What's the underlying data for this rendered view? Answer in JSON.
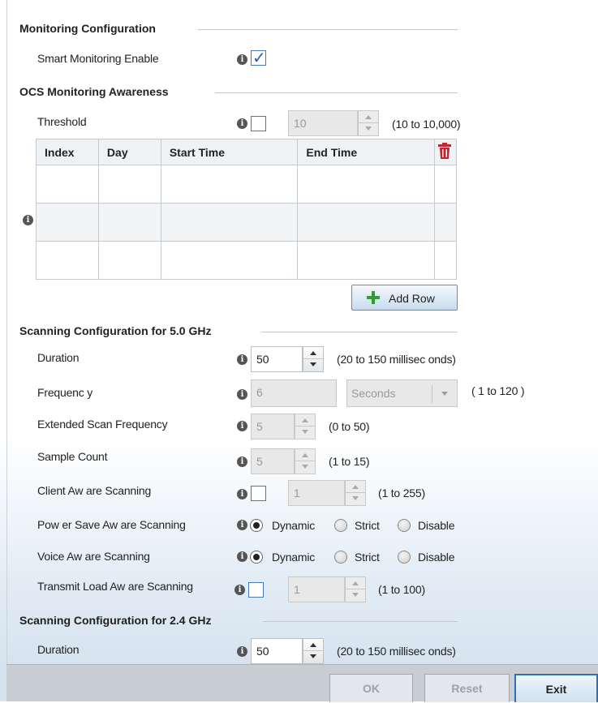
{
  "monitoring": {
    "title": "Monitoring Configuration",
    "smart_monitoring_label": "Smart Monitoring Enable",
    "smart_monitoring_checked": true
  },
  "ocs": {
    "title": "OCS Monitoring Awareness",
    "threshold_label": "Threshold",
    "threshold_checked": false,
    "threshold_value": "10",
    "threshold_range": "(10 to 10,000)",
    "table": {
      "columns": [
        "Index",
        "Day",
        "Start Time",
        "End Time"
      ],
      "rows": []
    },
    "add_row_label": "Add Row"
  },
  "scan5": {
    "title": "Scanning Configuration for 5.0 GHz",
    "duration_label": "Duration",
    "duration_value": "50",
    "duration_range": "(20 to 150 millisec onds)",
    "frequency_label": "Frequenc y",
    "frequency_value": "6",
    "frequency_unit": "Seconds",
    "frequency_range": "( 1 to 120 )",
    "ext_scan_label": "Extended Scan Frequency",
    "ext_scan_value": "5",
    "ext_scan_range": "(0 to 50)",
    "sample_count_label": "Sample Count",
    "sample_count_value": "5",
    "sample_count_range": "(1 to 15)",
    "client_aware_label": "Client Aw are Scanning",
    "client_aware_checked": false,
    "client_aware_value": "1",
    "client_aware_range": "(1 to 255)",
    "power_save_label": "Pow er Save Aw are Scanning",
    "voice_aware_label": "Voice Aw are Scanning",
    "radio_options": [
      "Dynamic",
      "Strict",
      "Disable"
    ],
    "power_save_selected": "Dynamic",
    "voice_aware_selected": "Dynamic",
    "transmit_load_label": "Transmit Load Aw are Scanning",
    "transmit_load_checked": false,
    "transmit_load_value": "1",
    "transmit_load_range": "(1 to 100)"
  },
  "scan24": {
    "title": "Scanning Configuration for 2.4 GHz",
    "duration_label": "Duration",
    "duration_value": "50",
    "duration_range": "(20 to 150 millisec onds)"
  },
  "footer": {
    "ok_label": "OK",
    "reset_label": "Reset",
    "exit_label": "Exit"
  },
  "colors": {
    "accent": "#2f6fb3",
    "add_icon": "#2f9e2f",
    "delete_icon": "#c0262d"
  }
}
